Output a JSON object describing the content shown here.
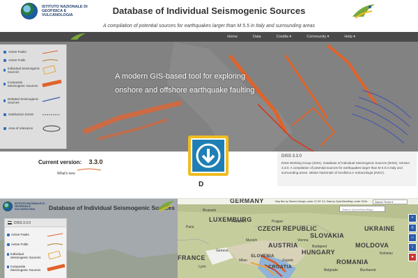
{
  "site": {
    "org_name": "Istituto Nazionale di Geofisica e Vulcanologia",
    "title": "Database of Individual Seismogenic Sources",
    "subtitle": "A compilation of potential sources for earthquakes larger than M 5.5 in Italy and surrounding areas",
    "nav": [
      "Home",
      "Data",
      "Credits ▾",
      "Community ▾",
      "Help ▾"
    ],
    "legend_items": [
      "Active Faults",
      "Active Folds",
      "Individual Seismogenic Sources",
      "Composite Seismogenic Sources",
      "Debated Seismogenic Sources",
      "Subduction Zones",
      "Area of relevance"
    ],
    "hero_line1": "A modern GIS-based tool for exploring",
    "hero_line2": "onshore and offshore earthquake faulting",
    "current_version_label": "Current version:",
    "current_version": "3.3.0",
    "whats_new": "What's new",
    "data_heading_partial": "D",
    "citation_title": "DISS 3.3.0",
    "citation_body": "DISS Working Group (2021). Database of Individual Seismogenic Sources (DISS), Version 3.3.0: A compilation of potential sources for earthquakes larger than M 5.5 in Italy and surrounding areas. Istituto Nazionale di Geofisica e Vulcanologia (INGV).",
    "colors": {
      "navbar": "#4a4a4a",
      "download_frame": "#f0bc21",
      "download_fill": "#1f7fb4",
      "source_orange": "#e0632a"
    }
  },
  "app": {
    "org_name": "Istituto Nazionale di Geofisica e Vulcanologia",
    "title": "Database of Individual Seismogenic Sources",
    "map_attribution": "Map tiles by Stamen Design, under CC BY 3.0. Data by OpenStreetMap, under ODbL",
    "basemap_select": "Stamen Terrain",
    "search_placeholder": "Search (OpenStreetMap)",
    "layer_panel": {
      "title": "DISS 3.3.0",
      "layers": [
        "Active Faults",
        "Active Folds",
        "Individual Seismogenic Sources",
        "Composite Seismogenic Sources"
      ]
    },
    "map_labels": {
      "countries": [
        "GERMANY",
        "LUXEMBURG",
        "CZECH REPUBLIC",
        "SLOVAKIA",
        "UKRAINE",
        "AUSTRIA",
        "HUNGARY",
        "MOLDOVA",
        "FRANCE",
        "ROMANIA",
        "SLOVENIA",
        "CROATIA"
      ],
      "cities": [
        "Brussels",
        "Paris",
        "Frankfurt",
        "Prague",
        "Vienna",
        "Munich",
        "Budapest",
        "Kishinev",
        "Lyon",
        "Belgrade",
        "Bucharest",
        "Geneva",
        "Milan",
        "Zagreb"
      ]
    }
  }
}
